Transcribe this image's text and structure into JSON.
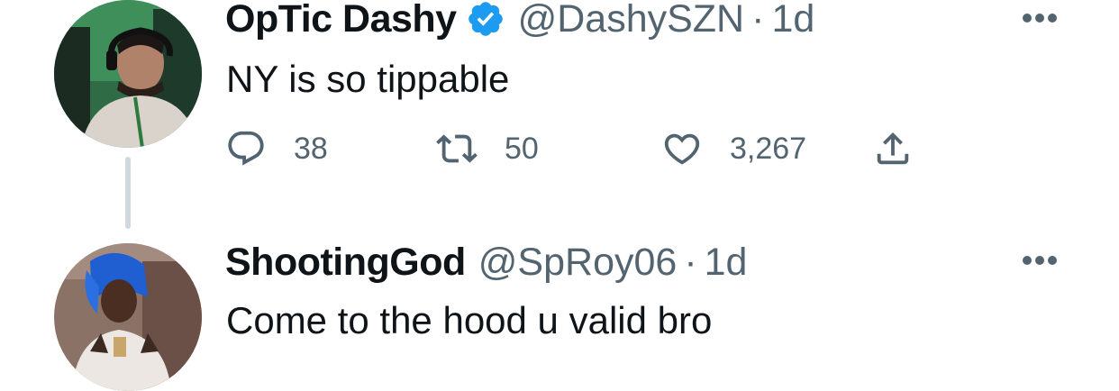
{
  "tweets": [
    {
      "display_name": "OpTic Dashy",
      "verified": true,
      "handle": "@DashySZN",
      "separator": "·",
      "time": "1d",
      "text": "NY is so tippable",
      "avatar_icon": "avatar-photo",
      "more_icon": "more-horizontal-icon",
      "actions": {
        "reply_count": "38",
        "retweet_count": "50",
        "like_count": "3,267"
      }
    },
    {
      "display_name": "ShootingGod",
      "verified": false,
      "handle": "@SpRoy06",
      "separator": "·",
      "time": "1d",
      "text": "Come to the hood u valid bro",
      "avatar_icon": "avatar-photo",
      "more_icon": "more-horizontal-icon"
    }
  ],
  "colors": {
    "text_primary": "#0f1419",
    "text_secondary": "#536471",
    "verified_blue": "#1d9bf0",
    "thread_line": "#cfd9de"
  }
}
